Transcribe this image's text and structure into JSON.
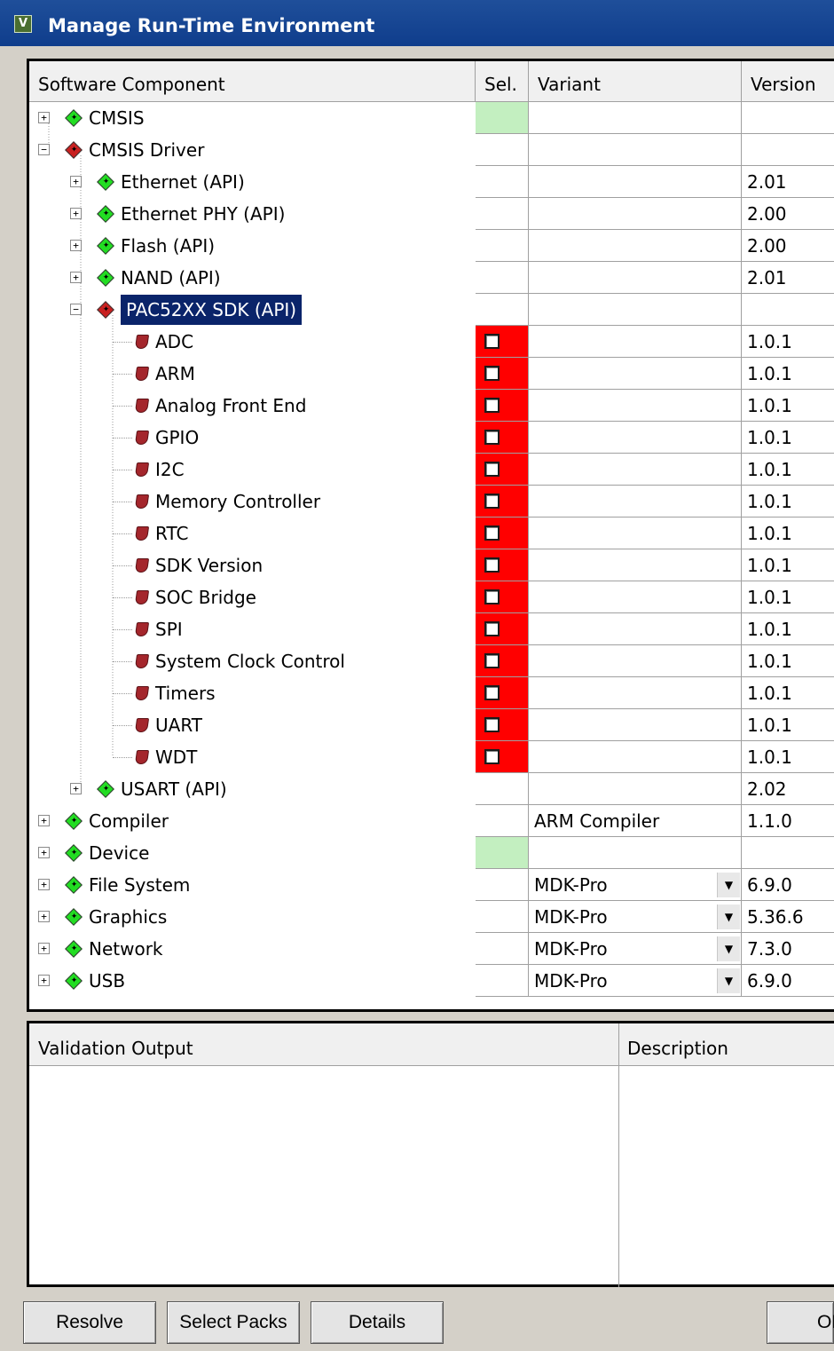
{
  "window": {
    "title": "Manage Run-Time Environment"
  },
  "columns": {
    "component": "Software Component",
    "sel": "Sel.",
    "variant": "Variant",
    "version": "Version"
  },
  "rows": [
    {
      "label": "CMSIS",
      "level": 0,
      "expander": "+",
      "icon": "green-diamond-icon",
      "sel": "green",
      "variant": "",
      "version": "",
      "dropdown": false
    },
    {
      "label": "CMSIS Driver",
      "level": 0,
      "expander": "-",
      "icon": "red-diamond-icon",
      "sel": "",
      "variant": "",
      "version": "",
      "dropdown": false
    },
    {
      "label": "Ethernet (API)",
      "level": 1,
      "expander": "+",
      "icon": "green-diamond-icon",
      "sel": "",
      "variant": "",
      "version": "2.01",
      "dropdown": false
    },
    {
      "label": "Ethernet PHY (API)",
      "level": 1,
      "expander": "+",
      "icon": "green-diamond-icon",
      "sel": "",
      "variant": "",
      "version": "2.00",
      "dropdown": false
    },
    {
      "label": "Flash (API)",
      "level": 1,
      "expander": "+",
      "icon": "green-diamond-icon",
      "sel": "",
      "variant": "",
      "version": "2.00",
      "dropdown": false
    },
    {
      "label": "NAND (API)",
      "level": 1,
      "expander": "+",
      "icon": "green-diamond-icon",
      "sel": "",
      "variant": "",
      "version": "2.01",
      "dropdown": false
    },
    {
      "label": "PAC52XX SDK (API)",
      "level": 1,
      "expander": "-",
      "icon": "red-diamond-icon",
      "sel": "",
      "variant": "",
      "version": "",
      "dropdown": false,
      "selected": true
    },
    {
      "label": "ADC",
      "level": 2,
      "expander": "",
      "icon": "red-gem-icon",
      "sel": "red",
      "variant": "",
      "version": "1.0.1",
      "dropdown": false
    },
    {
      "label": "ARM",
      "level": 2,
      "expander": "",
      "icon": "red-gem-icon",
      "sel": "red",
      "variant": "",
      "version": "1.0.1",
      "dropdown": false
    },
    {
      "label": "Analog Front End",
      "level": 2,
      "expander": "",
      "icon": "red-gem-icon",
      "sel": "red",
      "variant": "",
      "version": "1.0.1",
      "dropdown": false
    },
    {
      "label": "GPIO",
      "level": 2,
      "expander": "",
      "icon": "red-gem-icon",
      "sel": "red",
      "variant": "",
      "version": "1.0.1",
      "dropdown": false
    },
    {
      "label": "I2C",
      "level": 2,
      "expander": "",
      "icon": "red-gem-icon",
      "sel": "red",
      "variant": "",
      "version": "1.0.1",
      "dropdown": false
    },
    {
      "label": "Memory Controller",
      "level": 2,
      "expander": "",
      "icon": "red-gem-icon",
      "sel": "red",
      "variant": "",
      "version": "1.0.1",
      "dropdown": false
    },
    {
      "label": "RTC",
      "level": 2,
      "expander": "",
      "icon": "red-gem-icon",
      "sel": "red",
      "variant": "",
      "version": "1.0.1",
      "dropdown": false
    },
    {
      "label": "SDK Version",
      "level": 2,
      "expander": "",
      "icon": "red-gem-icon",
      "sel": "red",
      "variant": "",
      "version": "1.0.1",
      "dropdown": false
    },
    {
      "label": "SOC Bridge",
      "level": 2,
      "expander": "",
      "icon": "red-gem-icon",
      "sel": "red",
      "variant": "",
      "version": "1.0.1",
      "dropdown": false
    },
    {
      "label": "SPI",
      "level": 2,
      "expander": "",
      "icon": "red-gem-icon",
      "sel": "red",
      "variant": "",
      "version": "1.0.1",
      "dropdown": false
    },
    {
      "label": "System Clock Control",
      "level": 2,
      "expander": "",
      "icon": "red-gem-icon",
      "sel": "red",
      "variant": "",
      "version": "1.0.1",
      "dropdown": false
    },
    {
      "label": "Timers",
      "level": 2,
      "expander": "",
      "icon": "red-gem-icon",
      "sel": "red",
      "variant": "",
      "version": "1.0.1",
      "dropdown": false
    },
    {
      "label": "UART",
      "level": 2,
      "expander": "",
      "icon": "red-gem-icon",
      "sel": "red",
      "variant": "",
      "version": "1.0.1",
      "dropdown": false
    },
    {
      "label": "WDT",
      "level": 2,
      "expander": "",
      "icon": "red-gem-icon",
      "sel": "red",
      "variant": "",
      "version": "1.0.1",
      "dropdown": false
    },
    {
      "label": "USART (API)",
      "level": 1,
      "expander": "+",
      "icon": "green-diamond-icon",
      "sel": "",
      "variant": "",
      "version": "2.02",
      "dropdown": false
    },
    {
      "label": "Compiler",
      "level": 0,
      "expander": "+",
      "icon": "green-diamond-icon",
      "sel": "",
      "variant": "ARM Compiler",
      "version": "1.1.0",
      "dropdown": false
    },
    {
      "label": "Device",
      "level": 0,
      "expander": "+",
      "icon": "green-diamond-icon",
      "sel": "green",
      "variant": "",
      "version": "",
      "dropdown": false
    },
    {
      "label": "File System",
      "level": 0,
      "expander": "+",
      "icon": "green-diamond-icon",
      "sel": "",
      "variant": "MDK-Pro",
      "version": "6.9.0",
      "dropdown": true
    },
    {
      "label": "Graphics",
      "level": 0,
      "expander": "+",
      "icon": "green-diamond-icon",
      "sel": "",
      "variant": "MDK-Pro",
      "version": "5.36.6",
      "dropdown": true
    },
    {
      "label": "Network",
      "level": 0,
      "expander": "+",
      "icon": "green-diamond-icon",
      "sel": "",
      "variant": "MDK-Pro",
      "version": "7.3.0",
      "dropdown": true
    },
    {
      "label": "USB",
      "level": 0,
      "expander": "+",
      "icon": "green-diamond-icon",
      "sel": "",
      "variant": "MDK-Pro",
      "version": "6.9.0",
      "dropdown": true
    }
  ],
  "validation": {
    "col_output": "Validation Output",
    "col_description": "Description"
  },
  "buttons": {
    "resolve": "Resolve",
    "select_packs": "Select Packs",
    "details": "Details",
    "ok": "OK"
  }
}
